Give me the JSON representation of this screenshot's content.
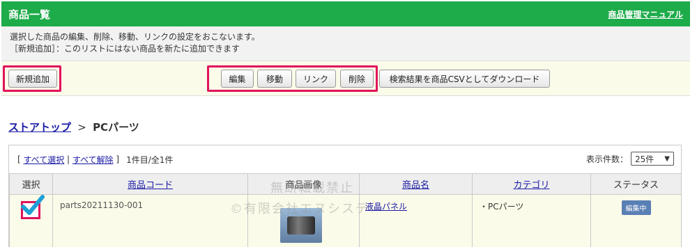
{
  "header": {
    "title": "商品一覧",
    "manual_link": "商品管理マニュアル"
  },
  "info": {
    "line1": "選択した商品の編集、削除、移動、リンクの設定をおこないます。",
    "line2": "［新規追加］：このリストにはない商品を新たに追加できます"
  },
  "toolbar": {
    "new_label": "新規追加",
    "edit_label": "編集",
    "move_label": "移動",
    "link_label": "リンク",
    "delete_label": "削除",
    "csv_label": "検索結果を商品CSVとしてダウンロード"
  },
  "breadcrumb": {
    "top": "ストアトップ",
    "separator": ">",
    "current": "PCパーツ"
  },
  "list": {
    "bracket_open": "[",
    "select_all": "すべて選択",
    "divider": "|",
    "deselect_all": "すべて解除",
    "bracket_close": "]",
    "count": "1件目/全1件",
    "per_page_label": "表示件数：",
    "per_page_value": "25件",
    "columns": {
      "select": "選択",
      "code": "商品コード",
      "image": "商品画像",
      "name": "商品名",
      "category": "カテゴリ",
      "status": "ステータス"
    },
    "rows": [
      {
        "checked": true,
        "code": "parts20211130-001",
        "name": "液晶パネル",
        "category": "・PCパーツ",
        "status": "編集中"
      }
    ]
  },
  "watermark": {
    "line1": "無断転載禁止",
    "line2": "©有限会社エヌシステ"
  },
  "colors": {
    "header": "#1eab4a",
    "highlight": "#e1125b",
    "link": "#1a1aa6",
    "badge": "#5a7fb5",
    "check": "#1e9fd6"
  }
}
